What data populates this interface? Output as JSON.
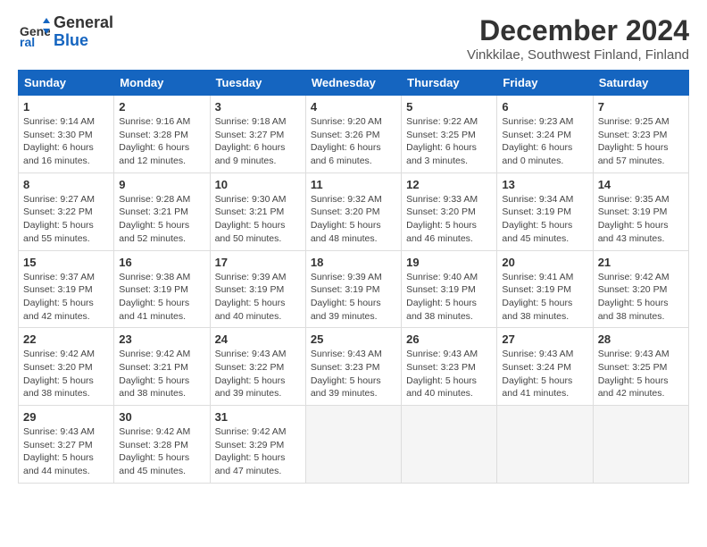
{
  "header": {
    "logo_general": "General",
    "logo_blue": "Blue",
    "title": "December 2024",
    "subtitle": "Vinkkilae, Southwest Finland, Finland"
  },
  "days_of_week": [
    "Sunday",
    "Monday",
    "Tuesday",
    "Wednesday",
    "Thursday",
    "Friday",
    "Saturday"
  ],
  "weeks": [
    [
      {
        "day": "1",
        "info": "Sunrise: 9:14 AM\nSunset: 3:30 PM\nDaylight: 6 hours and 16 minutes."
      },
      {
        "day": "2",
        "info": "Sunrise: 9:16 AM\nSunset: 3:28 PM\nDaylight: 6 hours and 12 minutes."
      },
      {
        "day": "3",
        "info": "Sunrise: 9:18 AM\nSunset: 3:27 PM\nDaylight: 6 hours and 9 minutes."
      },
      {
        "day": "4",
        "info": "Sunrise: 9:20 AM\nSunset: 3:26 PM\nDaylight: 6 hours and 6 minutes."
      },
      {
        "day": "5",
        "info": "Sunrise: 9:22 AM\nSunset: 3:25 PM\nDaylight: 6 hours and 3 minutes."
      },
      {
        "day": "6",
        "info": "Sunrise: 9:23 AM\nSunset: 3:24 PM\nDaylight: 6 hours and 0 minutes."
      },
      {
        "day": "7",
        "info": "Sunrise: 9:25 AM\nSunset: 3:23 PM\nDaylight: 5 hours and 57 minutes."
      }
    ],
    [
      {
        "day": "8",
        "info": "Sunrise: 9:27 AM\nSunset: 3:22 PM\nDaylight: 5 hours and 55 minutes."
      },
      {
        "day": "9",
        "info": "Sunrise: 9:28 AM\nSunset: 3:21 PM\nDaylight: 5 hours and 52 minutes."
      },
      {
        "day": "10",
        "info": "Sunrise: 9:30 AM\nSunset: 3:21 PM\nDaylight: 5 hours and 50 minutes."
      },
      {
        "day": "11",
        "info": "Sunrise: 9:32 AM\nSunset: 3:20 PM\nDaylight: 5 hours and 48 minutes."
      },
      {
        "day": "12",
        "info": "Sunrise: 9:33 AM\nSunset: 3:20 PM\nDaylight: 5 hours and 46 minutes."
      },
      {
        "day": "13",
        "info": "Sunrise: 9:34 AM\nSunset: 3:19 PM\nDaylight: 5 hours and 45 minutes."
      },
      {
        "day": "14",
        "info": "Sunrise: 9:35 AM\nSunset: 3:19 PM\nDaylight: 5 hours and 43 minutes."
      }
    ],
    [
      {
        "day": "15",
        "info": "Sunrise: 9:37 AM\nSunset: 3:19 PM\nDaylight: 5 hours and 42 minutes."
      },
      {
        "day": "16",
        "info": "Sunrise: 9:38 AM\nSunset: 3:19 PM\nDaylight: 5 hours and 41 minutes."
      },
      {
        "day": "17",
        "info": "Sunrise: 9:39 AM\nSunset: 3:19 PM\nDaylight: 5 hours and 40 minutes."
      },
      {
        "day": "18",
        "info": "Sunrise: 9:39 AM\nSunset: 3:19 PM\nDaylight: 5 hours and 39 minutes."
      },
      {
        "day": "19",
        "info": "Sunrise: 9:40 AM\nSunset: 3:19 PM\nDaylight: 5 hours and 38 minutes."
      },
      {
        "day": "20",
        "info": "Sunrise: 9:41 AM\nSunset: 3:19 PM\nDaylight: 5 hours and 38 minutes."
      },
      {
        "day": "21",
        "info": "Sunrise: 9:42 AM\nSunset: 3:20 PM\nDaylight: 5 hours and 38 minutes."
      }
    ],
    [
      {
        "day": "22",
        "info": "Sunrise: 9:42 AM\nSunset: 3:20 PM\nDaylight: 5 hours and 38 minutes."
      },
      {
        "day": "23",
        "info": "Sunrise: 9:42 AM\nSunset: 3:21 PM\nDaylight: 5 hours and 38 minutes."
      },
      {
        "day": "24",
        "info": "Sunrise: 9:43 AM\nSunset: 3:22 PM\nDaylight: 5 hours and 39 minutes."
      },
      {
        "day": "25",
        "info": "Sunrise: 9:43 AM\nSunset: 3:23 PM\nDaylight: 5 hours and 39 minutes."
      },
      {
        "day": "26",
        "info": "Sunrise: 9:43 AM\nSunset: 3:23 PM\nDaylight: 5 hours and 40 minutes."
      },
      {
        "day": "27",
        "info": "Sunrise: 9:43 AM\nSunset: 3:24 PM\nDaylight: 5 hours and 41 minutes."
      },
      {
        "day": "28",
        "info": "Sunrise: 9:43 AM\nSunset: 3:25 PM\nDaylight: 5 hours and 42 minutes."
      }
    ],
    [
      {
        "day": "29",
        "info": "Sunrise: 9:43 AM\nSunset: 3:27 PM\nDaylight: 5 hours and 44 minutes."
      },
      {
        "day": "30",
        "info": "Sunrise: 9:42 AM\nSunset: 3:28 PM\nDaylight: 5 hours and 45 minutes."
      },
      {
        "day": "31",
        "info": "Sunrise: 9:42 AM\nSunset: 3:29 PM\nDaylight: 5 hours and 47 minutes."
      },
      {
        "day": "",
        "info": ""
      },
      {
        "day": "",
        "info": ""
      },
      {
        "day": "",
        "info": ""
      },
      {
        "day": "",
        "info": ""
      }
    ]
  ]
}
